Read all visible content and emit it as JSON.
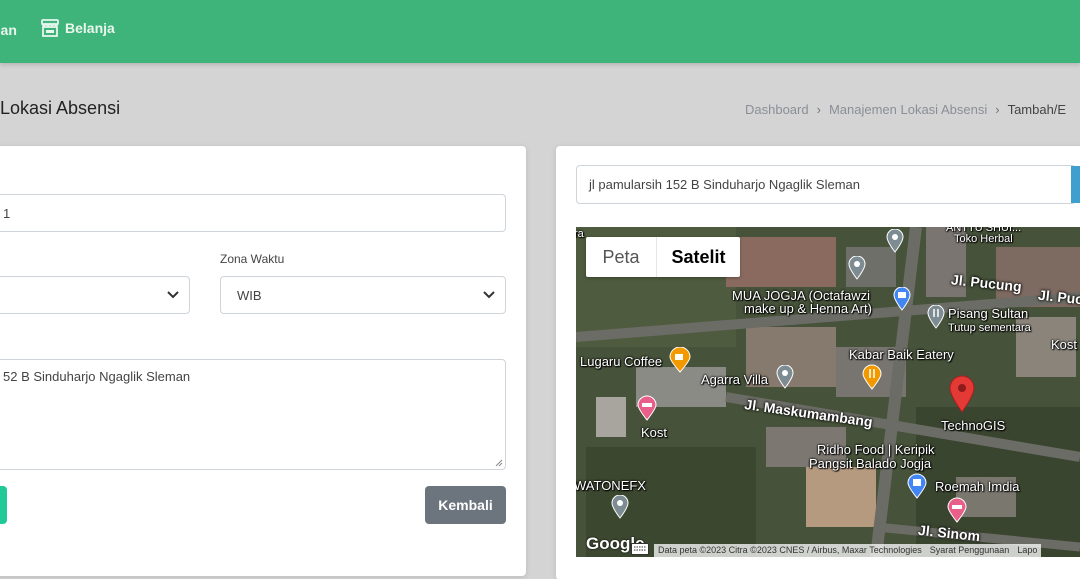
{
  "nav": {
    "partial_label": "uan",
    "shop_label": "Belanja"
  },
  "page": {
    "title": "it Lokasi Absensi"
  },
  "breadcrumb": {
    "items": [
      "Dashboard",
      "Manajemen Lokasi Absensi",
      "Tambah/E"
    ],
    "separator": "›"
  },
  "form": {
    "name_value": "1",
    "zone_label": "Zona Waktu",
    "zone_value": "WIB",
    "address_value": "52 B Sinduharjo Ngaglik Sleman",
    "back_label": "Kembali"
  },
  "map": {
    "search_value": "jl pamularsih 152 B Sinduharjo Ngaglik Sleman",
    "toggle_map": "Peta",
    "toggle_satellite": "Satelit",
    "pois": {
      "toko": "Toko Herbal",
      "topcut": "ANTTU SHUI...",
      "mua_1": "MUA JOGJA (Octafawzi",
      "mua_2": "make up & Henna Art)",
      "pisang_1": "Pisang Sultan",
      "pisang_2": "Tutup sementara",
      "kost_right": "Kost",
      "lugaru": "Lugaru Coffee",
      "kabar": "Kabar Baik Eatery",
      "agarra": "Agarra Villa",
      "technogis": "TechnoGIS",
      "kost": "Kost",
      "ridho_1": "Ridho Food | Keripik",
      "ridho_2": "Pangsit Balado Jogja",
      "watonefx": "WATONEFX",
      "roemah": "Roemah Imdia",
      "ra": "ra"
    },
    "streets": {
      "pucung": "Jl. Pucung",
      "pucung2": "Jl. Puc",
      "maskumambang": "Jl. Maskumambang",
      "sinom": "Jl. Sinom"
    },
    "footer": {
      "google": "Google",
      "attribution": "Data peta ©2023 Citra ©2023 CNES / Airbus, Maxar Technologies",
      "terms": "Syarat Penggunaan",
      "report": "Lapo"
    },
    "colors": {
      "technogis_pin": "#e53935",
      "food_pin": "#f29900",
      "lodging_pin": "#e8608a",
      "shop_pin": "#4285f4",
      "generic_pin": "#7d8b92"
    }
  },
  "colors": {
    "topbar": "#3fb47a",
    "back_button": "#6c757d",
    "save_button": "#20c997"
  }
}
